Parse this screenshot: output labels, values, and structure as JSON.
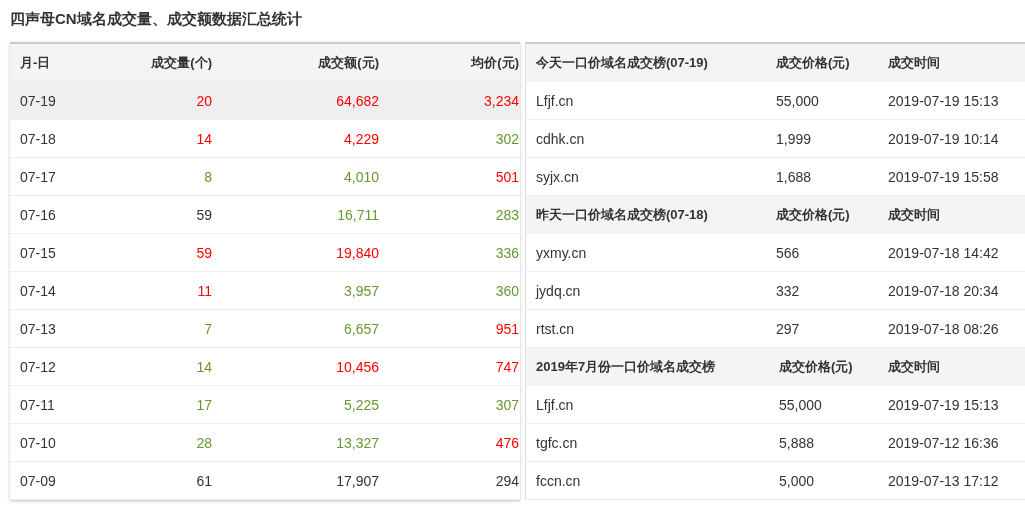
{
  "title": "四声母CN域名成交量、成交额数据汇总统计",
  "daily_table": {
    "columns": [
      "月-日",
      "成交量(个)",
      "成交额(元)",
      "均价(元)"
    ],
    "rows": [
      {
        "selected": true,
        "cells": [
          {
            "text": "07-19"
          },
          {
            "text": "20",
            "color": "#ff0000"
          },
          {
            "text": "64,682",
            "color": "#ff0000"
          },
          {
            "text": "3,234",
            "color": "#ff0000"
          }
        ]
      },
      {
        "selected": false,
        "cells": [
          {
            "text": "07-18"
          },
          {
            "text": "14",
            "color": "#ff0000"
          },
          {
            "text": "4,229",
            "color": "#ff0000"
          },
          {
            "text": "302",
            "color": "#669933"
          }
        ]
      },
      {
        "selected": false,
        "cells": [
          {
            "text": "07-17"
          },
          {
            "text": "8",
            "color": "#669933"
          },
          {
            "text": "4,010",
            "color": "#669933"
          },
          {
            "text": "501",
            "color": "#ff0000"
          }
        ]
      },
      {
        "selected": false,
        "cells": [
          {
            "text": "07-16"
          },
          {
            "text": "59",
            "color": "#333333"
          },
          {
            "text": "16,711",
            "color": "#669933"
          },
          {
            "text": "283",
            "color": "#669933"
          }
        ]
      },
      {
        "selected": false,
        "cells": [
          {
            "text": "07-15"
          },
          {
            "text": "59",
            "color": "#ff0000"
          },
          {
            "text": "19,840",
            "color": "#ff0000"
          },
          {
            "text": "336",
            "color": "#669933"
          }
        ]
      },
      {
        "selected": false,
        "cells": [
          {
            "text": "07-14"
          },
          {
            "text": "11",
            "color": "#ff0000"
          },
          {
            "text": "3,957",
            "color": "#669933"
          },
          {
            "text": "360",
            "color": "#669933"
          }
        ]
      },
      {
        "selected": false,
        "cells": [
          {
            "text": "07-13"
          },
          {
            "text": "7",
            "color": "#669933"
          },
          {
            "text": "6,657",
            "color": "#669933"
          },
          {
            "text": "951",
            "color": "#ff0000"
          }
        ]
      },
      {
        "selected": false,
        "cells": [
          {
            "text": "07-12"
          },
          {
            "text": "14",
            "color": "#669933"
          },
          {
            "text": "10,456",
            "color": "#ff0000"
          },
          {
            "text": "747",
            "color": "#ff0000"
          }
        ]
      },
      {
        "selected": false,
        "cells": [
          {
            "text": "07-11"
          },
          {
            "text": "17",
            "color": "#669933"
          },
          {
            "text": "5,225",
            "color": "#669933"
          },
          {
            "text": "307",
            "color": "#669933"
          }
        ]
      },
      {
        "selected": false,
        "cells": [
          {
            "text": "07-10"
          },
          {
            "text": "28",
            "color": "#669933"
          },
          {
            "text": "13,327",
            "color": "#669933"
          },
          {
            "text": "476",
            "color": "#ff0000"
          }
        ]
      },
      {
        "selected": false,
        "cells": [
          {
            "text": "07-09"
          },
          {
            "text": "61",
            "color": "#333333"
          },
          {
            "text": "17,907",
            "color": "#333333"
          },
          {
            "text": "294",
            "color": "#333333"
          }
        ]
      }
    ]
  },
  "rankings": [
    {
      "columns": [
        "今天一口价域名成交榜(07-19)",
        "成交价格(元)",
        "成交时间"
      ],
      "rows": [
        {
          "domain": "Lfjf.cn",
          "price": "55,000",
          "time": "2019-07-19 15:13"
        },
        {
          "domain": "cdhk.cn",
          "price": "1,999",
          "time": "2019-07-19 10:14"
        },
        {
          "domain": "syjx.cn",
          "price": "1,688",
          "time": "2019-07-19 15:58"
        }
      ]
    },
    {
      "columns": [
        "昨天一口价域名成交榜(07-18)",
        "成交价格(元)",
        "成交时间"
      ],
      "rows": [
        {
          "domain": "yxmy.cn",
          "price": "566",
          "time": "2019-07-18 14:42"
        },
        {
          "domain": "jydq.cn",
          "price": "332",
          "time": "2019-07-18 20:34"
        },
        {
          "domain": "rtst.cn",
          "price": "297",
          "time": "2019-07-18 08:26"
        }
      ]
    },
    {
      "columns": [
        "2019年7月份一口价域名成交榜",
        "成交价格(元)",
        "成交时间"
      ],
      "rows": [
        {
          "domain": "Lfjf.cn",
          "price": "55,000",
          "time": "2019-07-19 15:13"
        },
        {
          "domain": "tgfc.cn",
          "price": "5,888",
          "time": "2019-07-12 16:36"
        },
        {
          "domain": "fccn.cn",
          "price": "5,000",
          "time": "2019-07-13 17:12"
        }
      ]
    }
  ]
}
